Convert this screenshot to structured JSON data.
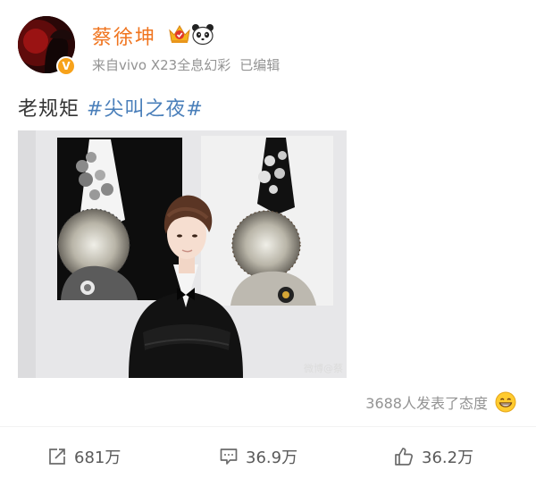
{
  "user": {
    "name": "蔡徐坤",
    "verified_badge": "V"
  },
  "meta": {
    "source": "来自vivo X23全息幻彩",
    "edited": "已编辑"
  },
  "post": {
    "text": "老规矩 ",
    "hashtag": "#尖叫之夜#"
  },
  "image": {
    "watermark": "微博@蔡"
  },
  "reactions": {
    "text": "3688人发表了态度",
    "emoji": "grin-emoji"
  },
  "actions": {
    "repost": "681万",
    "comment": "36.9万",
    "like": "36.2万"
  },
  "colors": {
    "username": "#f0741e",
    "hashtag": "#4a7fba",
    "meta": "#939393",
    "badge": "#f7a21b"
  }
}
